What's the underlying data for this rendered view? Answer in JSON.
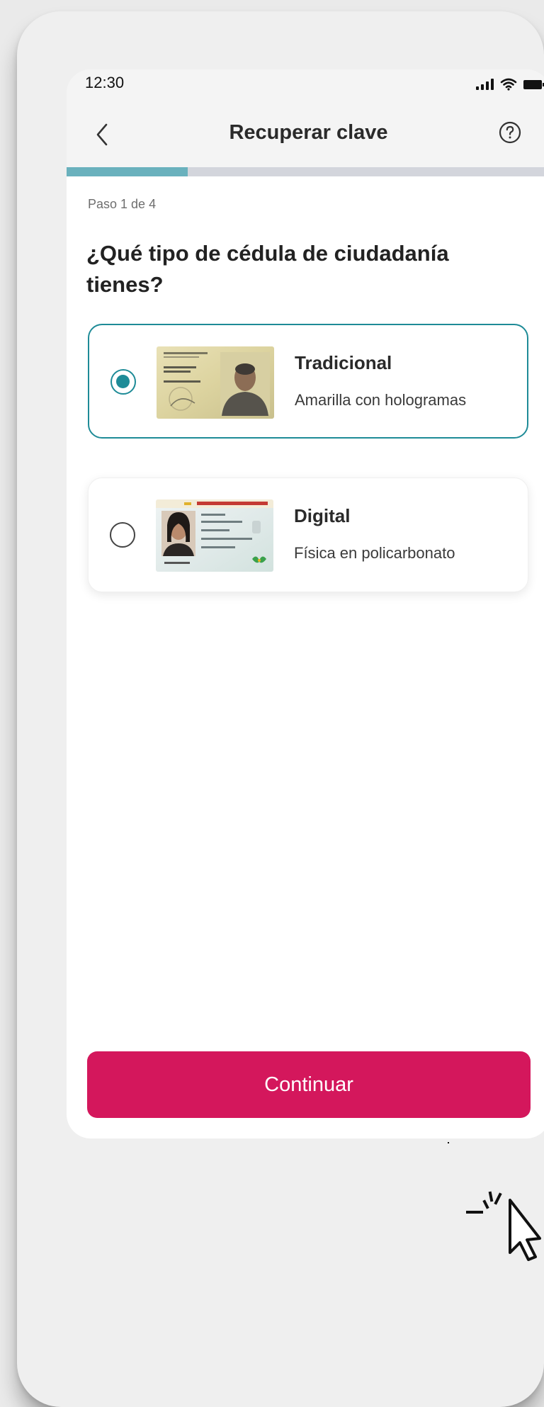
{
  "status_bar": {
    "time": "12:30",
    "icons": [
      "signal-icon",
      "wifi-icon",
      "battery-icon"
    ]
  },
  "header": {
    "title": "Recuperar clave",
    "back_icon": "chevron-left-icon",
    "help_icon": "question-circle-icon"
  },
  "progress": {
    "step_label": "Paso 1 de 4",
    "current_step": 1,
    "total_steps": 4,
    "fill_fraction": 0.25
  },
  "question": "¿Qué tipo de cédula de ciudadanía tienes?",
  "options": [
    {
      "title": "Tradicional",
      "subtitle": "Amarilla con hologramas",
      "selected": true,
      "image": "yellow-id-card-image"
    },
    {
      "title": "Digital",
      "subtitle": "Física en policarbonato",
      "selected": false,
      "image": "digital-id-card-image"
    }
  ],
  "continue_label": "Continuar",
  "colors": {
    "accent": "#1e8b97",
    "progress": "#6ab1bd",
    "primary_button": "#d4175c",
    "header_bg": "#f4f4f4"
  }
}
